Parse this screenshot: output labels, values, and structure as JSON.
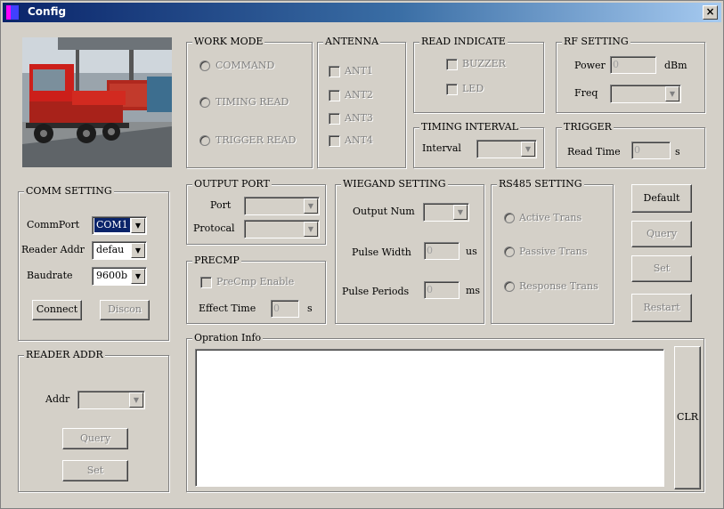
{
  "window": {
    "title": "Config",
    "close_label": "×"
  },
  "photo": {
    "description_icon": "truck-photo"
  },
  "work_mode": {
    "legend": "WORK MODE",
    "options": [
      "COMMAND",
      "TIMING READ",
      "TRIGGER READ"
    ]
  },
  "antenna": {
    "legend": "ANTENNA",
    "options": [
      "ANT1",
      "ANT2",
      "ANT3",
      "ANT4"
    ]
  },
  "read_indicate": {
    "legend": "READ INDICATE",
    "options": [
      "BUZZER",
      "LED"
    ]
  },
  "rf_setting": {
    "legend": "RF SETTING",
    "power_label": "Power",
    "power_value": "0",
    "power_unit": "dBm",
    "freq_label": "Freq",
    "freq_value": ""
  },
  "timing_interval": {
    "legend": "TIMING INTERVAL",
    "interval_label": "Interval",
    "interval_value": ""
  },
  "trigger": {
    "legend": "TRIGGER",
    "read_time_label": "Read Time",
    "read_time_value": "0",
    "read_time_unit": "s"
  },
  "comm_setting": {
    "legend": "COMM SETTING",
    "commport_label": "CommPort",
    "commport_value": "COM1",
    "reader_addr_label": "Reader Addr",
    "reader_addr_value": "defau",
    "baudrate_label": "Baudrate",
    "baudrate_value": "9600b",
    "connect_label": "Connect",
    "discon_label": "Discon"
  },
  "output_port": {
    "legend": "OUTPUT PORT",
    "port_label": "Port",
    "port_value": "",
    "protocal_label": "Protocal",
    "protocal_value": ""
  },
  "precmp": {
    "legend": "PRECMP",
    "enable_label": "PreCmp Enable",
    "effect_time_label": "Effect Time",
    "effect_time_value": "0",
    "effect_time_unit": "s"
  },
  "wiegand": {
    "legend": "WIEGAND SETTING",
    "output_num_label": "Output Num",
    "output_num_value": "",
    "pulse_width_label": "Pulse Width",
    "pulse_width_value": "0",
    "pulse_width_unit": "us",
    "pulse_periods_label": "Pulse Periods",
    "pulse_periods_value": "0",
    "pulse_periods_unit": "ms"
  },
  "rs485": {
    "legend": "RS485 SETTING",
    "options": [
      "Active Trans",
      "Passive Trans",
      "Response Trans"
    ]
  },
  "actions": {
    "default_label": "Default",
    "query_label": "Query",
    "set_label": "Set",
    "restart_label": "Restart"
  },
  "reader_addr": {
    "legend": "READER ADDR",
    "addr_label": "Addr",
    "addr_value": "",
    "query_label": "Query",
    "set_label": "Set"
  },
  "opration_info": {
    "legend": "Opration Info",
    "text": "",
    "clr_label": "CLR"
  }
}
